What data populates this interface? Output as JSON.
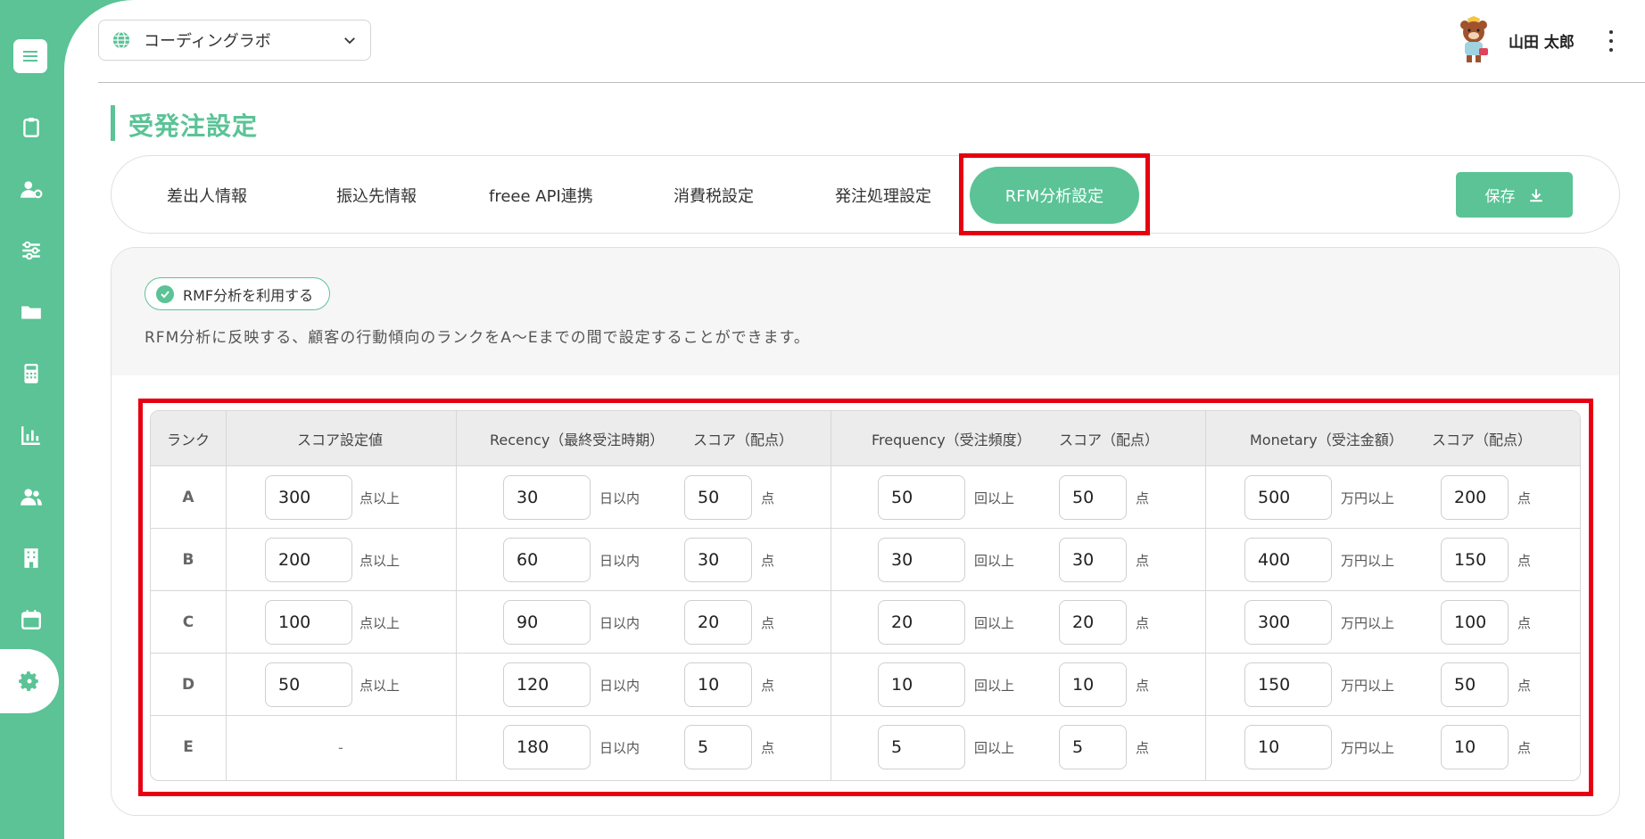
{
  "org_select": {
    "label": "コーディングラボ"
  },
  "user": {
    "name": "山田 太郎"
  },
  "page_title": "受発注設定",
  "tabs": [
    {
      "label": "差出人情報"
    },
    {
      "label": "振込先情報"
    },
    {
      "label": "freee API連携"
    },
    {
      "label": "消費税設定"
    },
    {
      "label": "発注処理設定"
    },
    {
      "label": "RFM分析設定",
      "active": true
    }
  ],
  "save_button": {
    "label": "保存"
  },
  "rfm_toggle": {
    "label": "RMF分析を利用する",
    "checked": true
  },
  "description": "RFM分析に反映する、顧客の行動傾向のランクをA〜Eまでの間で設定することができます。",
  "table": {
    "headers": {
      "rank": "ランク",
      "score_setting": "スコア設定値",
      "recency": "Recency（最終受注時期）",
      "recency_score": "スコア（配点）",
      "frequency": "Frequency（受注頻度）",
      "frequency_score": "スコア（配点）",
      "monetary": "Monetary（受注金額）",
      "monetary_score": "スコア（配点）"
    },
    "units": {
      "score": "点以上",
      "recency": "日以内",
      "frequency": "回以上",
      "monetary": "万円以上",
      "points": "点"
    },
    "rows": [
      {
        "rank": "A",
        "score": "300",
        "recency": "30",
        "recency_score": "50",
        "frequency": "50",
        "frequency_score": "50",
        "monetary": "500",
        "monetary_score": "200"
      },
      {
        "rank": "B",
        "score": "200",
        "recency": "60",
        "recency_score": "30",
        "frequency": "30",
        "frequency_score": "30",
        "monetary": "400",
        "monetary_score": "150"
      },
      {
        "rank": "C",
        "score": "100",
        "recency": "90",
        "recency_score": "20",
        "frequency": "20",
        "frequency_score": "20",
        "monetary": "300",
        "monetary_score": "100"
      },
      {
        "rank": "D",
        "score": "50",
        "recency": "120",
        "recency_score": "10",
        "frequency": "10",
        "frequency_score": "10",
        "monetary": "150",
        "monetary_score": "50"
      },
      {
        "rank": "E",
        "score": "-",
        "recency": "180",
        "recency_score": "5",
        "frequency": "5",
        "frequency_score": "5",
        "monetary": "10",
        "monetary_score": "10"
      }
    ]
  },
  "colors": {
    "accent": "#5bc396",
    "highlight": "#e60012"
  },
  "sidebar_icons": [
    "menu-icon",
    "clipboard-icon",
    "user-settings-icon",
    "sliders-icon",
    "folder-icon",
    "calculator-icon",
    "bar-chart-icon",
    "users-icon",
    "building-icon",
    "calendar-icon",
    "gear-icon"
  ]
}
